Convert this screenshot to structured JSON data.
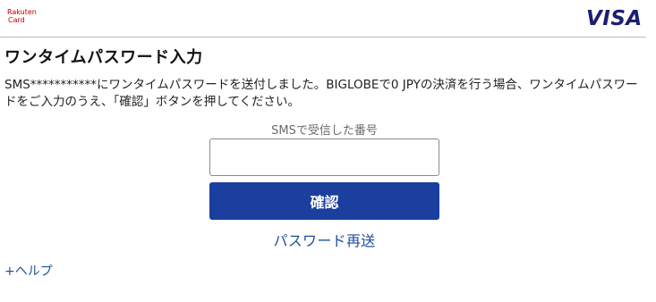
{
  "header": {
    "rakuten_logo_line1": "Rakuten",
    "rakuten_logo_line2": "Card",
    "visa_logo": "VISA",
    "brand_color": "#bf0000",
    "visa_color": "#1a1f71"
  },
  "main": {
    "title": "ワンタイムパスワード入力",
    "message": "SMS***********にワンタイムパスワードを送付しました。BIGLOBEで0 JPYの決済を行う場合、ワンタイムパスワードをご入力のうえ、「確認」ボタンを押してください。",
    "field_label": "SMSで受信した番号",
    "field_value": "",
    "confirm_label": "確認",
    "resend_label": "パスワード再送",
    "help_label": "+ヘルプ",
    "button_color": "#1a3f9e",
    "link_color": "#1f4f9e"
  }
}
